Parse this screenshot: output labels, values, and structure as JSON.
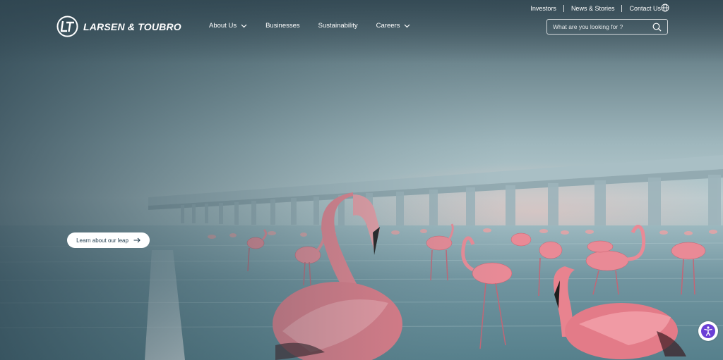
{
  "brand": {
    "name": "LARSEN & TOUBRO",
    "logo_icon": "lt-logo-icon"
  },
  "utility_nav": {
    "items": [
      "Investors",
      "News & Stories",
      "Contact Us"
    ],
    "globe_icon": "globe-icon"
  },
  "main_nav": {
    "items": [
      {
        "label": "About Us",
        "has_dropdown": true
      },
      {
        "label": "Businesses",
        "has_dropdown": false
      },
      {
        "label": "Sustainability",
        "has_dropdown": false
      },
      {
        "label": "Careers",
        "has_dropdown": true
      }
    ]
  },
  "search": {
    "placeholder": "What are you looking for ?",
    "value": "",
    "icon": "search-icon"
  },
  "hero": {
    "cta_label": "Learn about our leap",
    "cta_icon": "arrow-right-icon"
  },
  "accessibility": {
    "icon": "accessibility-icon",
    "color": "#6b3fd6"
  },
  "colors": {
    "header_text": "#ffffff",
    "cta_text": "#1f3b4d",
    "flamingo": "#e98a96"
  }
}
